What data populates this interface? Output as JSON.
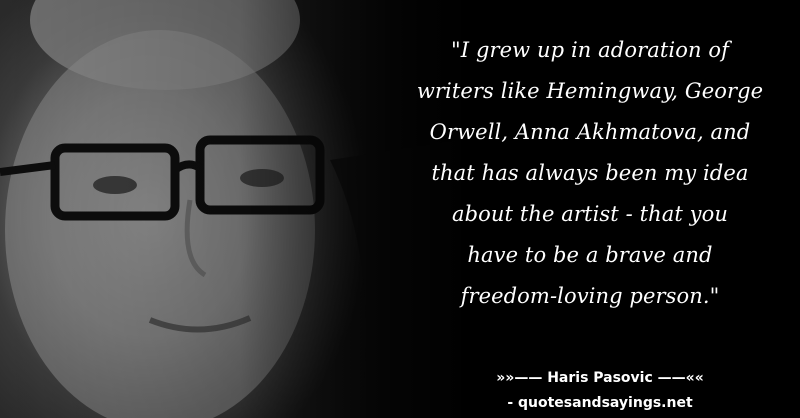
{
  "quote": {
    "lines": [
      "\"I grew up in adoration of",
      "writers like Hemingway, George",
      "Orwell, Anna Akhmatova, and",
      "that has always been my idea",
      "about the artist - that you",
      "have to be a brave and",
      "freedom-loving person.\""
    ]
  },
  "author": {
    "text": "»»—— Haris Pasovic ——««"
  },
  "source": {
    "text": "- quotesandsayings.net"
  },
  "colors": {
    "background": "#000000",
    "text": "#ffffff"
  }
}
